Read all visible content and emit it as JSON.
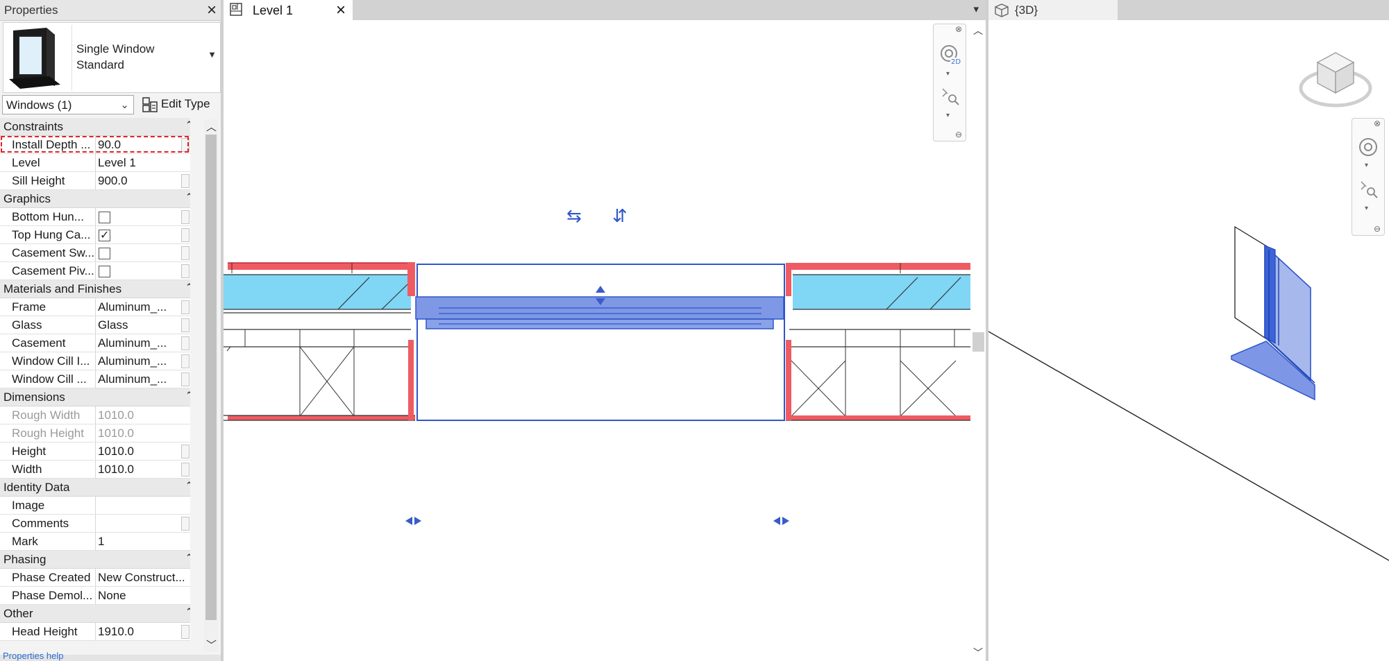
{
  "properties": {
    "title": "Properties",
    "type_name_line1": "Single Window",
    "type_name_line2": "Standard",
    "instance_selector": "Windows (1)",
    "edit_type_label": "Edit Type",
    "bottom_link": "Properties help",
    "categories": {
      "constraints": "Constraints",
      "graphics": "Graphics",
      "materials": "Materials and Finishes",
      "dimensions": "Dimensions",
      "identity": "Identity Data",
      "phasing": "Phasing",
      "other": "Other"
    },
    "rows": {
      "install_depth": {
        "name": "Install Depth ...",
        "value": "90.0"
      },
      "level": {
        "name": "Level",
        "value": "Level 1"
      },
      "sill_height": {
        "name": "Sill Height",
        "value": "900.0"
      },
      "bottom_hung": {
        "name": "Bottom Hun...",
        "checked": false
      },
      "top_hung": {
        "name": "Top Hung Ca...",
        "checked": true
      },
      "casement_sw": {
        "name": "Casement Sw...",
        "checked": false
      },
      "casement_piv": {
        "name": "Casement Piv...",
        "checked": false
      },
      "frame": {
        "name": "Frame",
        "value": "Aluminum_..."
      },
      "glass": {
        "name": "Glass",
        "value": "Glass"
      },
      "casement": {
        "name": "Casement",
        "value": "Aluminum_..."
      },
      "cill_1": {
        "name": "Window Cill I...",
        "value": "Aluminum_..."
      },
      "cill_2": {
        "name": "Window Cill ...",
        "value": "Aluminum_..."
      },
      "rough_width": {
        "name": "Rough Width",
        "value": "1010.0"
      },
      "rough_height": {
        "name": "Rough Height",
        "value": "1010.0"
      },
      "height": {
        "name": "Height",
        "value": "1010.0"
      },
      "width": {
        "name": "Width",
        "value": "1010.0"
      },
      "image": {
        "name": "Image",
        "value": ""
      },
      "comments": {
        "name": "Comments",
        "value": ""
      },
      "mark": {
        "name": "Mark",
        "value": "1"
      },
      "phase_created": {
        "name": "Phase Created",
        "value": "New Construct..."
      },
      "phase_demol": {
        "name": "Phase Demol...",
        "value": "None"
      },
      "head_height": {
        "name": "Head Height",
        "value": "1910.0"
      }
    },
    "check_glyph": "✓"
  },
  "plan_view": {
    "tab_label": "Level 1",
    "close_glyph": "×",
    "nav_badge": "2D"
  },
  "view_3d": {
    "tab_label": "{3D}"
  },
  "colors": {
    "selection_blue": "#2f56c8",
    "window_fill": "#7f98e6",
    "wall_red": "#ef5b62",
    "insulation_cyan": "#7fd6f5"
  }
}
